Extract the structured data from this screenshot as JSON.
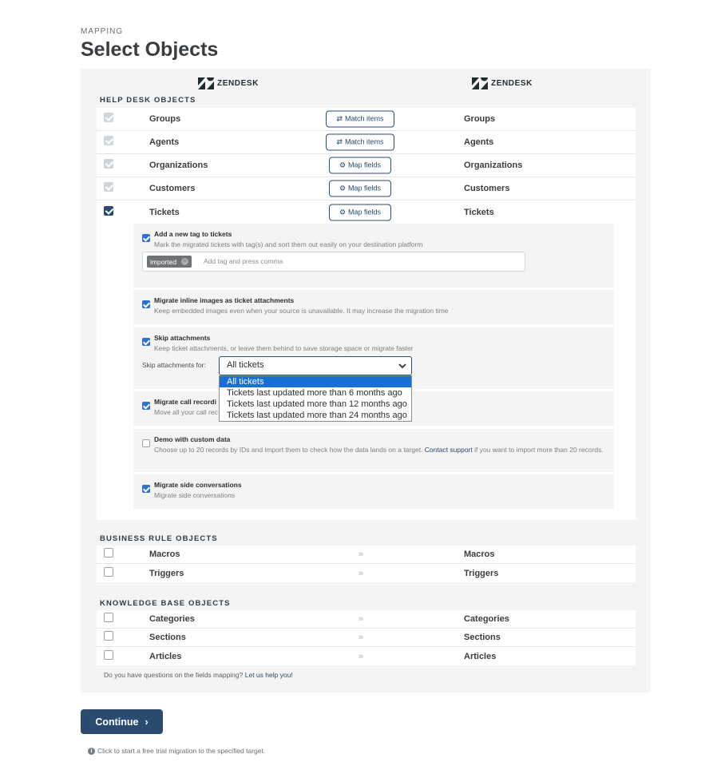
{
  "header": {
    "eyebrow": "MAPPING",
    "title": "Select Objects"
  },
  "platforms": {
    "source": "ZENDESK",
    "target": "ZENDESK",
    "logo_icon": "zendesk-logo",
    "logo_color": "#1f2d33"
  },
  "help_desk": {
    "section_title": "HELP DESK OBJECTS",
    "rows": [
      {
        "source": "Groups",
        "target": "Groups",
        "action": "Match items",
        "action_icon": "swap-arrows-icon",
        "checked": true,
        "disabled": true
      },
      {
        "source": "Agents",
        "target": "Agents",
        "action": "Match items",
        "action_icon": "swap-arrows-icon",
        "checked": true,
        "disabled": true
      },
      {
        "source": "Organizations",
        "target": "Organizations",
        "action": "Map fields",
        "action_icon": "gear-icon",
        "checked": true,
        "disabled": true
      },
      {
        "source": "Customers",
        "target": "Customers",
        "action": "Map fields",
        "action_icon": "gear-icon",
        "checked": true,
        "disabled": true
      },
      {
        "source": "Tickets",
        "target": "Tickets",
        "action": "Map fields",
        "action_icon": "gear-icon",
        "checked": true,
        "disabled": false
      }
    ],
    "ticket_options": {
      "tag": {
        "title": "Add a new tag to tickets",
        "description": "Mark the migrated tickets with tag(s) and sort them out easily on your destination platform",
        "tag_value": "imported",
        "placeholder": "Add tag and press comma",
        "checked": true
      },
      "inline_images": {
        "title": "Migrate inline images as ticket attachments",
        "description": "Keep embedded images even when your source is unavailable. It may increase the migration time",
        "checked": true
      },
      "skip_attachments": {
        "title": "Skip attachments",
        "description": "Keep ticket attachments, or leave them behind to save storage space or migrate faster",
        "label": "Skip attachments for:",
        "selected": "All tickets",
        "options": [
          "All tickets",
          "Tickets last updated more than 6 months ago",
          "Tickets last updated more than 12 months ago",
          "Tickets last updated more than 24 months ago"
        ],
        "checked": true
      },
      "call_recordings": {
        "title": "Migrate call recordi",
        "description": "Move all your call rec",
        "checked": true
      },
      "demo": {
        "title": "Demo with custom data",
        "description_before": "Choose up to 20 records by IDs and import them to check how the data lands on a target. ",
        "link": "Contact support",
        "description_after": " if you want to import more than 20 records.",
        "checked": false
      },
      "side_conversations": {
        "title": "Migrate side conversations",
        "description": "Migrate side conversations",
        "checked": true
      }
    }
  },
  "business_rules": {
    "section_title": "BUSINESS RULE OBJECTS",
    "rows": [
      {
        "source": "Macros",
        "target": "Macros",
        "arrows": "›››"
      },
      {
        "source": "Triggers",
        "target": "Triggers",
        "arrows": "›››"
      }
    ]
  },
  "knowledge_base": {
    "section_title": "KNOWLEDGE BASE OBJECTS",
    "rows": [
      {
        "source": "Categories",
        "target": "Categories",
        "arrows": "›››"
      },
      {
        "source": "Sections",
        "target": "Sections",
        "arrows": "›››"
      },
      {
        "source": "Articles",
        "target": "Articles",
        "arrows": "›››"
      }
    ]
  },
  "help": {
    "text": "Do you have questions on the fields mapping? ",
    "link": "Let us help you!"
  },
  "continue_label": "Continue",
  "footnote": "Click to start a free trial migration to the specified target.",
  "colors": {
    "primary": "#2b4a70",
    "select_highlight": "#1a6fd6",
    "panel_bg": "#f4f4f4"
  }
}
